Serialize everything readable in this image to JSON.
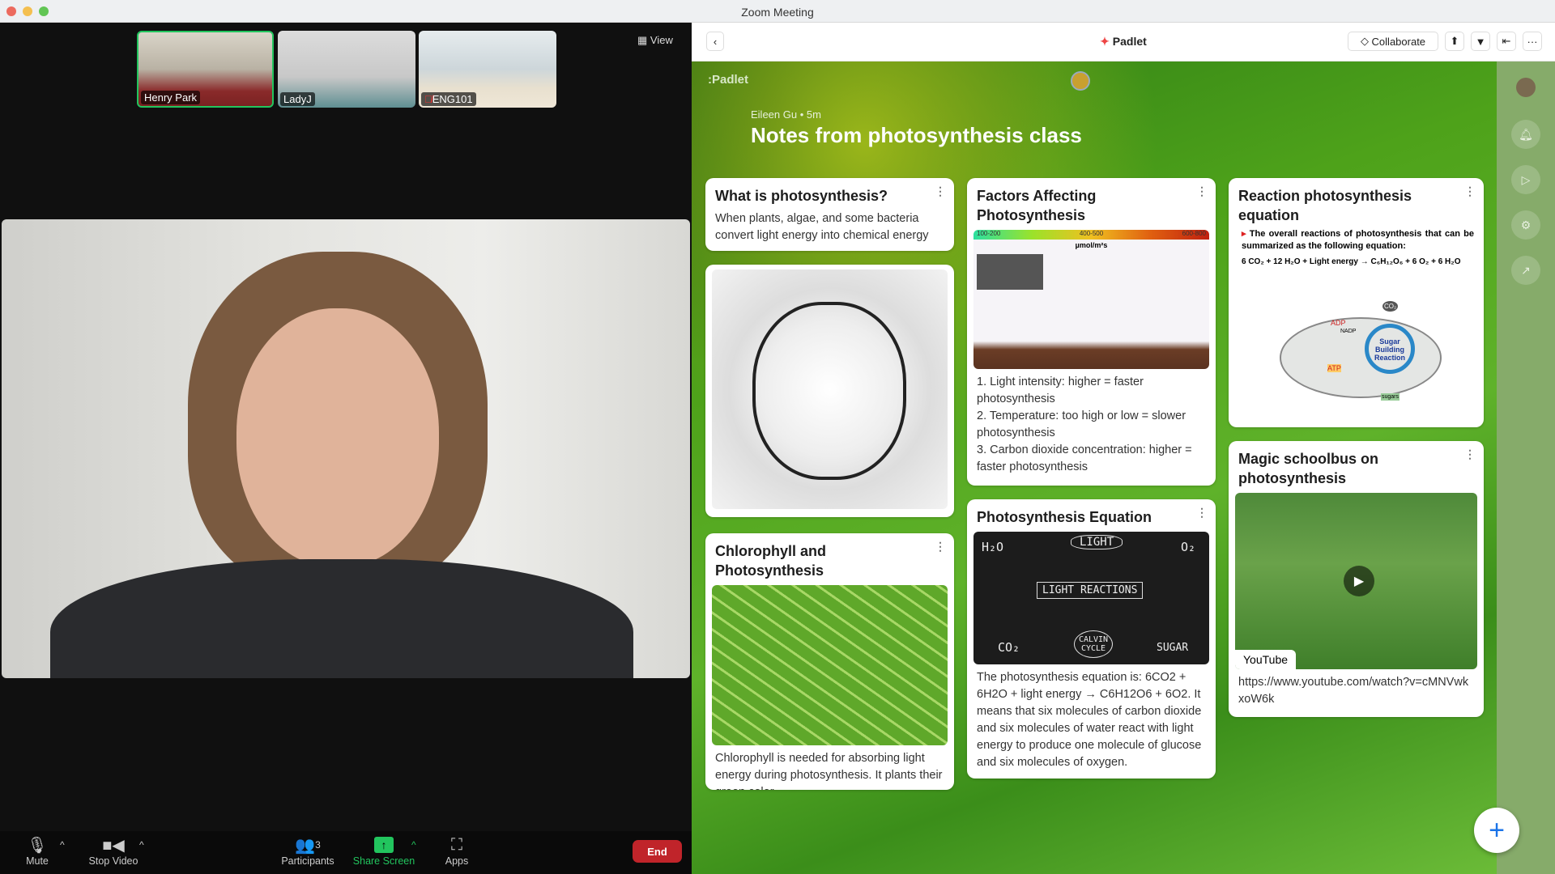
{
  "window": {
    "title": "Zoom Meeting"
  },
  "zoom": {
    "view_label": "View",
    "participants": [
      {
        "name": "Henry Park",
        "active": true
      },
      {
        "name": "LadyJ"
      },
      {
        "name": "ENG101",
        "muted": true
      }
    ],
    "toolbar": {
      "mute": "Mute",
      "stop_video": "Stop Video",
      "participants": "Participants",
      "participants_count": "3",
      "share_screen": "Share Screen",
      "apps": "Apps",
      "end": "End"
    },
    "colors": {
      "active_speaker": "#22c55e",
      "share": "#22c55e",
      "end": "#c0242a"
    }
  },
  "padlet": {
    "header": {
      "title": "Padlet",
      "collaborate": "Collaborate"
    },
    "board": {
      "logo": ":Padlet",
      "author": "Eileen Gu • 5m",
      "title": "Notes from photosynthesis class"
    },
    "cards": {
      "c1": {
        "title": "What is photosynthesis?",
        "body": "When plants, algae, and some bacteria convert light energy into chemical energy"
      },
      "c3": {
        "title": "Chlorophyll and Photosynthesis",
        "body": "Chlorophyll is needed for absorbing light energy during photosynthesis. It plants their green color."
      },
      "c4": {
        "title": "Factors Affecting Photosynthesis",
        "scale": [
          "100-200",
          "400-500",
          "600-800"
        ],
        "unit": "µmol/m²s",
        "lines": [
          "1. Light intensity: higher = faster photosynthesis",
          "2. Temperature: too high or low = slower photosynthesis",
          "3. Carbon dioxide concentration: higher = faster photosynthesis"
        ]
      },
      "c5": {
        "title": "Photosynthesis Equation",
        "board": {
          "light": "LIGHT",
          "reactions": "LIGHT REACTIONS",
          "h2o": "H₂O",
          "o2": "O₂",
          "co2": "CO₂",
          "calvin": "CALVIN CYCLE",
          "sugar": "SUGAR"
        },
        "body": "The photosynthesis equation is: 6CO2 + 6H2O + light energy → C6H12O6 + 6O2. It means that six molecules of carbon dioxide and six molecules of water react with light energy to produce one molecule of glucose and six molecules of oxygen."
      },
      "c6": {
        "title": "Reaction photosynthesis equation",
        "bullet": "The overall reactions of photosynthesis that can be summarized as the following equation:",
        "equation": "6 CO₂ + 12 H₂O + Light energy → C₆H₁₂O₆ + 6 O₂ + 6 H₂O",
        "labels": {
          "adp": "ADP",
          "nadp": "NADP",
          "atp": "ATP",
          "sugar": "Sugar Building Reaction",
          "co2": "CO₂",
          "sugars": "sugars"
        }
      },
      "c7": {
        "title": "Magic schoolbus on photosynthesis",
        "source": "YouTube",
        "url": "https://www.youtube.com/watch?v=cMNVwkxoW6k"
      }
    }
  }
}
